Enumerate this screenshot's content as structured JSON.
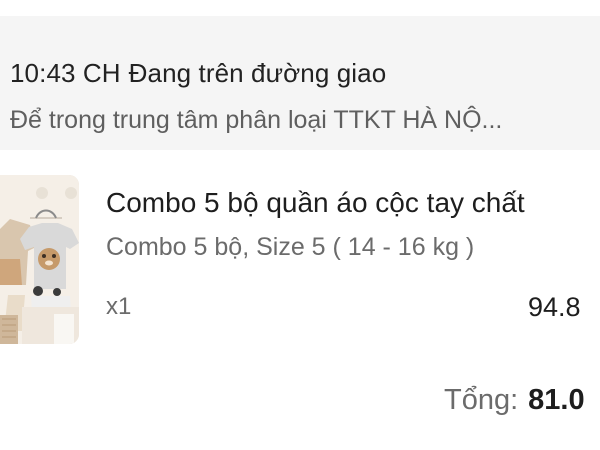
{
  "shipping_status": {
    "time": "10:43 CH",
    "status": "Đang trên đường giao",
    "location": "Để trong trung tâm phân loại TTKT HÀ NỘ..."
  },
  "product": {
    "image_icon": "product-thumbnail-image",
    "title": "Combo 5 bộ quần áo cộc tay chất",
    "variant": "Combo 5 bộ, Size 5 ( 14 - 16 kg )",
    "quantity": "x1",
    "price": "94.8"
  },
  "order_total": {
    "label": "Tổng:",
    "value": "81.0"
  },
  "colors": {
    "status_background": "#f5f5f5",
    "primary_text": "#1f1f1f",
    "secondary_text": "#6b6b6b"
  }
}
